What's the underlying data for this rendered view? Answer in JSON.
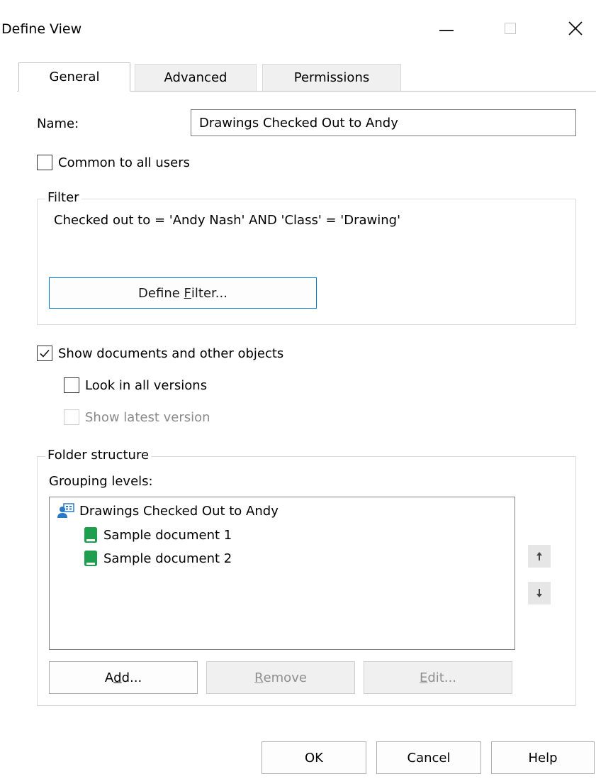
{
  "window": {
    "title": "Define View"
  },
  "tabs": [
    {
      "label": "General",
      "active": true
    },
    {
      "label": "Advanced",
      "active": false
    },
    {
      "label": "Permissions",
      "active": false
    }
  ],
  "general": {
    "name_label": "Name:",
    "name_value": "Drawings Checked Out to Andy",
    "common_label": "Common to all users",
    "common_checked": false
  },
  "filter": {
    "title": "Filter",
    "expression": "Checked out to = 'Andy Nash' AND 'Class' = 'Drawing'",
    "define_prefix": "Define ",
    "define_mnemonic": "F",
    "define_suffix": "ilter..."
  },
  "options": {
    "show_docs_label": "Show documents and other objects",
    "show_docs_checked": true,
    "all_versions_label": "Look in all versions",
    "all_versions_checked": false,
    "latest_label": "Show latest version",
    "latest_enabled": false
  },
  "folder_structure": {
    "title": "Folder structure",
    "grouping_label": "Grouping levels:",
    "root": "Drawings Checked Out to Andy",
    "children": [
      "Sample document 1",
      "Sample document 2"
    ],
    "add_prefix": "A",
    "add_mnemonic": "d",
    "add_suffix": "d...",
    "remove_mnemonic": "R",
    "remove_suffix": "emove",
    "edit_mnemonic": "E",
    "edit_suffix": "dit..."
  },
  "footer": {
    "ok": "OK",
    "cancel": "Cancel",
    "help": "Help"
  },
  "colors": {
    "accent": "#0078d7",
    "doc_icon": "#1e9e4f"
  }
}
